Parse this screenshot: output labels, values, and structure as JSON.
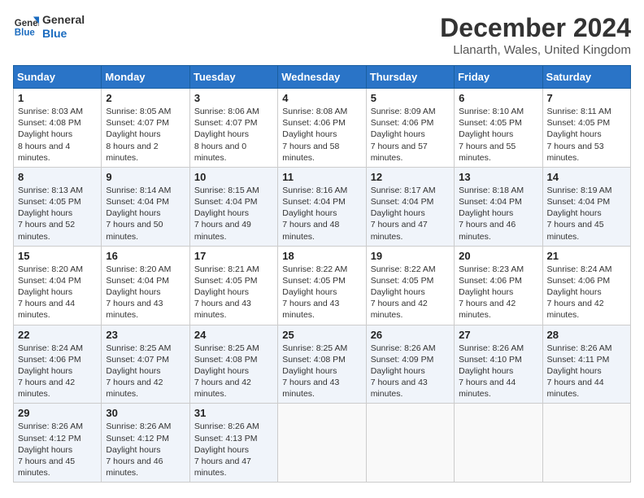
{
  "header": {
    "logo_line1": "General",
    "logo_line2": "Blue",
    "month": "December 2024",
    "location": "Llanarth, Wales, United Kingdom"
  },
  "days_of_week": [
    "Sunday",
    "Monday",
    "Tuesday",
    "Wednesday",
    "Thursday",
    "Friday",
    "Saturday"
  ],
  "weeks": [
    [
      {
        "day": "1",
        "sunrise": "8:03 AM",
        "sunset": "4:08 PM",
        "daylight": "8 hours and 4 minutes."
      },
      {
        "day": "2",
        "sunrise": "8:05 AM",
        "sunset": "4:07 PM",
        "daylight": "8 hours and 2 minutes."
      },
      {
        "day": "3",
        "sunrise": "8:06 AM",
        "sunset": "4:07 PM",
        "daylight": "8 hours and 0 minutes."
      },
      {
        "day": "4",
        "sunrise": "8:08 AM",
        "sunset": "4:06 PM",
        "daylight": "7 hours and 58 minutes."
      },
      {
        "day": "5",
        "sunrise": "8:09 AM",
        "sunset": "4:06 PM",
        "daylight": "7 hours and 57 minutes."
      },
      {
        "day": "6",
        "sunrise": "8:10 AM",
        "sunset": "4:05 PM",
        "daylight": "7 hours and 55 minutes."
      },
      {
        "day": "7",
        "sunrise": "8:11 AM",
        "sunset": "4:05 PM",
        "daylight": "7 hours and 53 minutes."
      }
    ],
    [
      {
        "day": "8",
        "sunrise": "8:13 AM",
        "sunset": "4:05 PM",
        "daylight": "7 hours and 52 minutes."
      },
      {
        "day": "9",
        "sunrise": "8:14 AM",
        "sunset": "4:04 PM",
        "daylight": "7 hours and 50 minutes."
      },
      {
        "day": "10",
        "sunrise": "8:15 AM",
        "sunset": "4:04 PM",
        "daylight": "7 hours and 49 minutes."
      },
      {
        "day": "11",
        "sunrise": "8:16 AM",
        "sunset": "4:04 PM",
        "daylight": "7 hours and 48 minutes."
      },
      {
        "day": "12",
        "sunrise": "8:17 AM",
        "sunset": "4:04 PM",
        "daylight": "7 hours and 47 minutes."
      },
      {
        "day": "13",
        "sunrise": "8:18 AM",
        "sunset": "4:04 PM",
        "daylight": "7 hours and 46 minutes."
      },
      {
        "day": "14",
        "sunrise": "8:19 AM",
        "sunset": "4:04 PM",
        "daylight": "7 hours and 45 minutes."
      }
    ],
    [
      {
        "day": "15",
        "sunrise": "8:20 AM",
        "sunset": "4:04 PM",
        "daylight": "7 hours and 44 minutes."
      },
      {
        "day": "16",
        "sunrise": "8:20 AM",
        "sunset": "4:04 PM",
        "daylight": "7 hours and 43 minutes."
      },
      {
        "day": "17",
        "sunrise": "8:21 AM",
        "sunset": "4:05 PM",
        "daylight": "7 hours and 43 minutes."
      },
      {
        "day": "18",
        "sunrise": "8:22 AM",
        "sunset": "4:05 PM",
        "daylight": "7 hours and 43 minutes."
      },
      {
        "day": "19",
        "sunrise": "8:22 AM",
        "sunset": "4:05 PM",
        "daylight": "7 hours and 42 minutes."
      },
      {
        "day": "20",
        "sunrise": "8:23 AM",
        "sunset": "4:06 PM",
        "daylight": "7 hours and 42 minutes."
      },
      {
        "day": "21",
        "sunrise": "8:24 AM",
        "sunset": "4:06 PM",
        "daylight": "7 hours and 42 minutes."
      }
    ],
    [
      {
        "day": "22",
        "sunrise": "8:24 AM",
        "sunset": "4:06 PM",
        "daylight": "7 hours and 42 minutes."
      },
      {
        "day": "23",
        "sunrise": "8:25 AM",
        "sunset": "4:07 PM",
        "daylight": "7 hours and 42 minutes."
      },
      {
        "day": "24",
        "sunrise": "8:25 AM",
        "sunset": "4:08 PM",
        "daylight": "7 hours and 42 minutes."
      },
      {
        "day": "25",
        "sunrise": "8:25 AM",
        "sunset": "4:08 PM",
        "daylight": "7 hours and 43 minutes."
      },
      {
        "day": "26",
        "sunrise": "8:26 AM",
        "sunset": "4:09 PM",
        "daylight": "7 hours and 43 minutes."
      },
      {
        "day": "27",
        "sunrise": "8:26 AM",
        "sunset": "4:10 PM",
        "daylight": "7 hours and 44 minutes."
      },
      {
        "day": "28",
        "sunrise": "8:26 AM",
        "sunset": "4:11 PM",
        "daylight": "7 hours and 44 minutes."
      }
    ],
    [
      {
        "day": "29",
        "sunrise": "8:26 AM",
        "sunset": "4:12 PM",
        "daylight": "7 hours and 45 minutes."
      },
      {
        "day": "30",
        "sunrise": "8:26 AM",
        "sunset": "4:12 PM",
        "daylight": "7 hours and 46 minutes."
      },
      {
        "day": "31",
        "sunrise": "8:26 AM",
        "sunset": "4:13 PM",
        "daylight": "7 hours and 47 minutes."
      },
      null,
      null,
      null,
      null
    ]
  ],
  "labels": {
    "sunrise": "Sunrise: ",
    "sunset": "Sunset: ",
    "daylight": "Daylight hours"
  }
}
